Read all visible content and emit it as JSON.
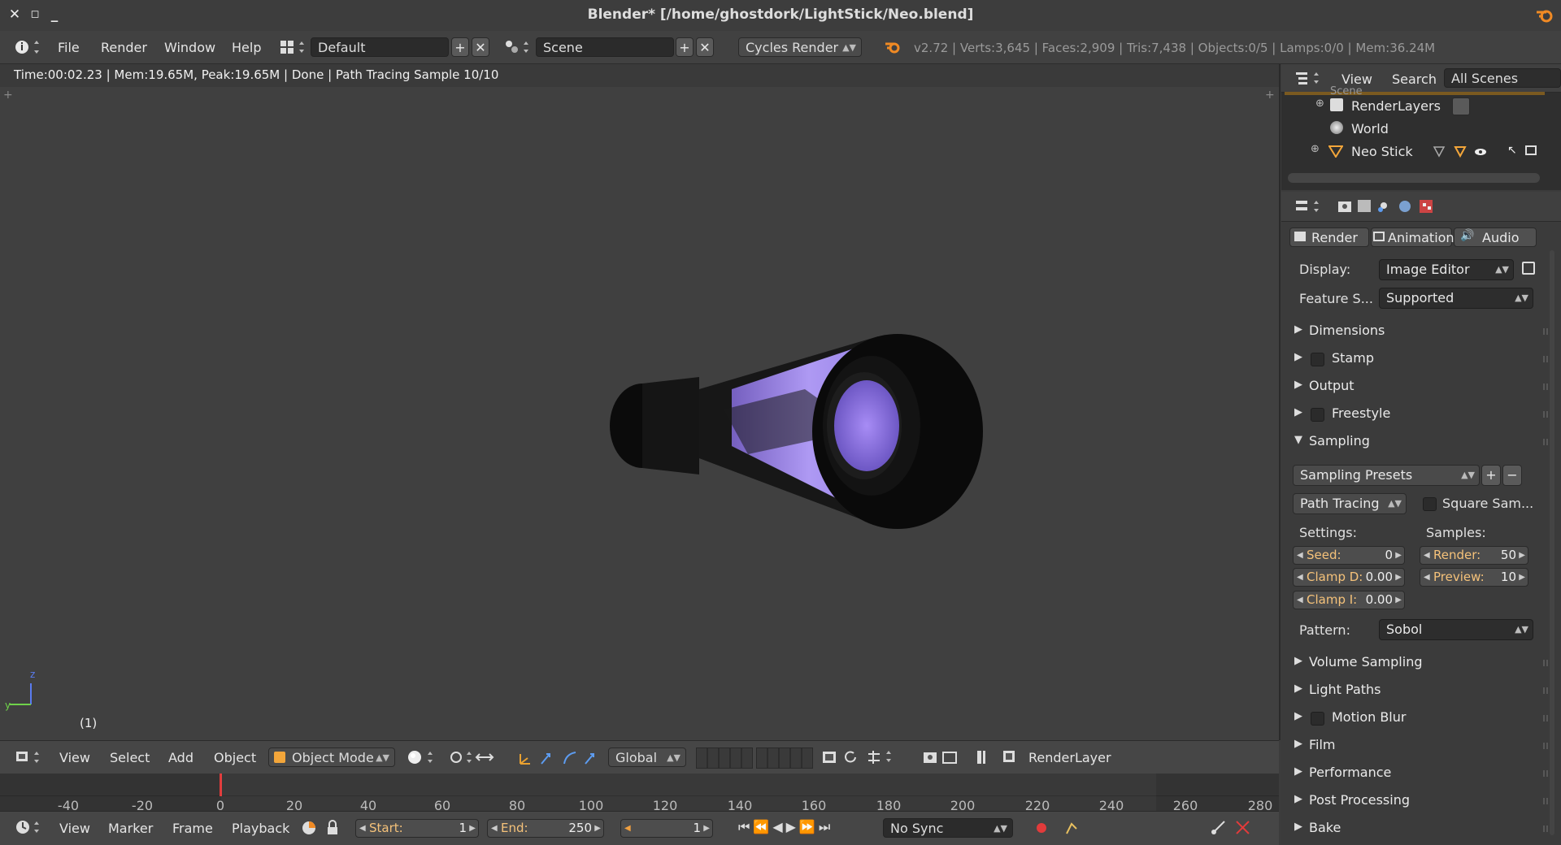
{
  "window": {
    "title": "Blender* [/home/ghostdork/LightStick/Neo.blend]"
  },
  "info_header": {
    "menus": [
      "File",
      "Render",
      "Window",
      "Help"
    ],
    "layout": "Default",
    "scene": "Scene",
    "engine": "Cycles Render",
    "stats": "v2.72 | Verts:3,645 | Faces:2,909 | Tris:7,438 | Objects:0/5 | Lamps:0/0 | Mem:36.24M"
  },
  "viewport": {
    "render_status": "Time:00:02.23 | Mem:19.65M, Peak:19.65M | Done | Path Tracing Sample 10/10",
    "frame_label": "(1)",
    "axis_x": "y",
    "axis_z": "z"
  },
  "view3d_header": {
    "menus": [
      "View",
      "Select",
      "Add",
      "Object"
    ],
    "mode": "Object Mode",
    "orientation": "Global",
    "render_layer": "RenderLayer"
  },
  "timeline": {
    "ticks": [
      "-40",
      "-20",
      "0",
      "20",
      "40",
      "60",
      "80",
      "100",
      "120",
      "140",
      "160",
      "180",
      "200",
      "220",
      "240",
      "260",
      "280"
    ],
    "menus": [
      "View",
      "Marker",
      "Frame",
      "Playback"
    ],
    "start_label": "Start:",
    "start_value": "1",
    "end_label": "End:",
    "end_value": "250",
    "current_frame": "1",
    "sync": "No Sync"
  },
  "outliner": {
    "menus": [
      "View",
      "Search"
    ],
    "filter": "All Scenes",
    "partial_top": "Scene",
    "items": [
      "RenderLayers",
      "World",
      "Neo Stick"
    ]
  },
  "properties": {
    "tabs": [
      "Render",
      "Animation",
      "Audio"
    ],
    "display_label": "Display:",
    "display_value": "Image Editor",
    "feature_label": "Feature S...",
    "feature_value": "Supported",
    "panels_top": [
      "Dimensions",
      "Stamp",
      "Output",
      "Freestyle",
      "Sampling"
    ],
    "sampling_presets": "Sampling Presets",
    "integrator": "Path Tracing",
    "square_samples": "Square Sam...",
    "settings_label": "Settings:",
    "samples_label": "Samples:",
    "seed_label": "Seed:",
    "seed_value": "0",
    "clamp_d_label": "Clamp D:",
    "clamp_d_value": "0.00",
    "clamp_i_label": "Clamp I:",
    "clamp_i_value": "0.00",
    "render_label": "Render:",
    "render_value": "50",
    "preview_label": "Preview:",
    "preview_value": "10",
    "pattern_label": "Pattern:",
    "pattern_value": "Sobol",
    "panels_bottom": [
      "Volume Sampling",
      "Light Paths",
      "Motion Blur",
      "Film",
      "Performance",
      "Post Processing",
      "Bake"
    ]
  },
  "colors": {
    "accent_orange": "#f0a040",
    "glow": "#a78cf5",
    "keyframe_red": "#e23b3b"
  }
}
